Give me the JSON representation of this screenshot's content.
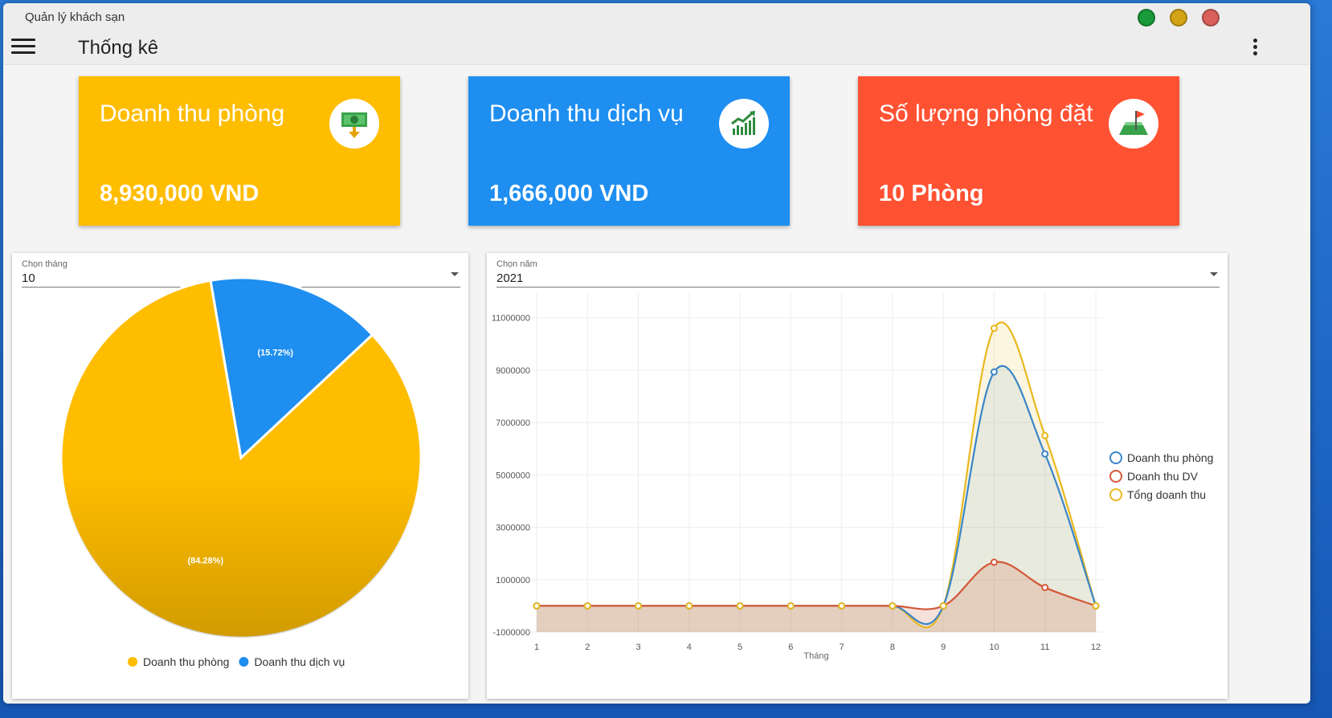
{
  "window": {
    "title": "Quản lý khách sạn",
    "dot_colors": [
      "#1a9a3a",
      "#d4a417",
      "#d9605a"
    ]
  },
  "appbar": {
    "title": "Thống kê",
    "menu_icon": "hamburger-icon",
    "more_icon": "more-vert-icon"
  },
  "cards": [
    {
      "label": "Doanh thu phòng",
      "value": "8,930,000 VND",
      "color": "#ffbd00",
      "icon": "money-icon"
    },
    {
      "label": "Doanh thu dịch vụ",
      "value": "1,666,000 VND",
      "color": "#1e8ef0",
      "icon": "chart-growth-icon"
    },
    {
      "label": "Số lượng phòng đặt",
      "value": "10 Phòng",
      "color": "#ff5233",
      "icon": "flag-icon"
    }
  ],
  "pie_panel": {
    "select_label": "Chọn tháng",
    "select_value": "10",
    "legend": [
      "Doanh thu phòng",
      "Doanh thu dịch vụ"
    ]
  },
  "line_panel": {
    "select_label": "Chọn năm",
    "select_value": "2021"
  },
  "chart_data": [
    {
      "type": "pie",
      "labels": [
        "Doanh thu phòng",
        "Doanh thu dịch vụ"
      ],
      "values": [
        84.28,
        15.72
      ],
      "slice_labels": [
        "(84.28%)",
        "(15.72%)"
      ],
      "colors": [
        "#ffbd00",
        "#1e8ef0"
      ],
      "legend_position": "bottom"
    },
    {
      "type": "area",
      "xlabel": "Tháng",
      "ylabel": "",
      "x": [
        1,
        2,
        3,
        4,
        5,
        6,
        7,
        8,
        9,
        10,
        11,
        12
      ],
      "x_ticks": [
        "1",
        "2",
        "3",
        "4",
        "5",
        "6",
        "7",
        "8",
        "9",
        "10",
        "11",
        "12"
      ],
      "y_ticks": [
        "11000000",
        "9000000",
        "7000000",
        "5000000",
        "3000000",
        "1000000",
        "-1000000"
      ],
      "ylim": [
        -1000000,
        12000000
      ],
      "grid": true,
      "legend_position": "right",
      "series": [
        {
          "name": "Doanh thu phòng",
          "color": "#3a86c8",
          "values": [
            0,
            0,
            0,
            0,
            0,
            0,
            0,
            0,
            0,
            8930000,
            5800000,
            0
          ]
        },
        {
          "name": "Doanh thu DV",
          "color": "#d3583a",
          "values": [
            0,
            0,
            0,
            0,
            0,
            0,
            0,
            0,
            0,
            1666000,
            700000,
            0
          ]
        },
        {
          "name": "Tổng doanh thu",
          "color": "#e8b820",
          "values": [
            0,
            0,
            0,
            0,
            0,
            0,
            0,
            0,
            0,
            10596000,
            6500000,
            0
          ]
        }
      ]
    }
  ]
}
